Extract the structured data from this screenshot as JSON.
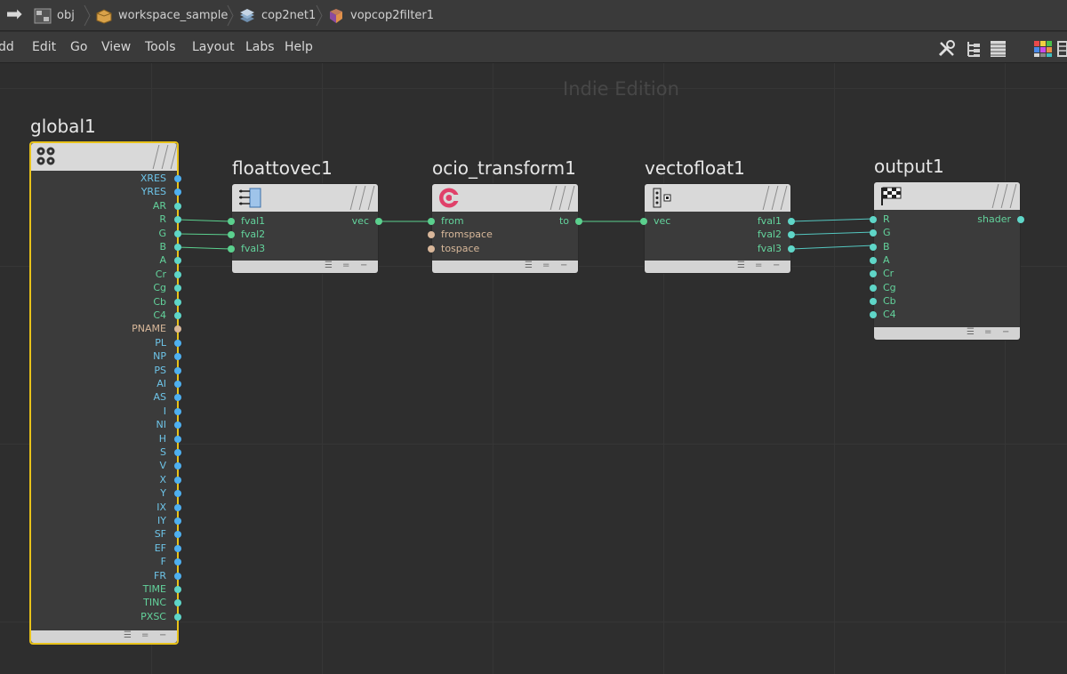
{
  "breadcrumb": {
    "items": [
      {
        "label": "obj",
        "icon": "obj-network-icon"
      },
      {
        "label": "workspace_sample",
        "icon": "subnet-box-icon"
      },
      {
        "label": "cop2net1",
        "icon": "cop2net-layers-icon"
      },
      {
        "label": "vopcop2filter1",
        "icon": "vopcop2filter-icon"
      }
    ]
  },
  "menu": {
    "items": [
      "dd",
      "Edit",
      "Go",
      "View",
      "Tools",
      "Layout",
      "Labs",
      "Help"
    ]
  },
  "canvas": {
    "watermark": "Indie Edition"
  },
  "nodes": {
    "global1": {
      "title": "global1",
      "outputs": [
        "XRES",
        "YRES",
        "AR",
        "R",
        "G",
        "B",
        "A",
        "Cr",
        "Cg",
        "Cb",
        "C4",
        "PNAME",
        "PL",
        "NP",
        "PS",
        "AI",
        "AS",
        "I",
        "NI",
        "H",
        "S",
        "V",
        "X",
        "Y",
        "IX",
        "IY",
        "SF",
        "EF",
        "F",
        "FR",
        "TIME",
        "TINC",
        "PXSC"
      ]
    },
    "floattovec1": {
      "title": "floattovec1",
      "inputs": [
        "fval1",
        "fval2",
        "fval3"
      ],
      "outputs": [
        "vec"
      ]
    },
    "ocio_transform1": {
      "title": "ocio_transform1",
      "inputs": [
        "from",
        "fromspace",
        "tospace"
      ],
      "outputs": [
        "to"
      ]
    },
    "vectofloat1": {
      "title": "vectofloat1",
      "inputs": [
        "vec"
      ],
      "outputs": [
        "fval1",
        "fval2",
        "fval3"
      ]
    },
    "output1": {
      "title": "output1",
      "inputs": [
        "R",
        "G",
        "B",
        "A",
        "Cr",
        "Cg",
        "Cb",
        "C4"
      ],
      "outputs": [
        "shader"
      ]
    }
  },
  "footer_glyphs": [
    "☰",
    "=",
    "−"
  ],
  "colors": {
    "selected_border": "#e8c21a",
    "wire": "#5bd08e",
    "wire_teal": "#54c7c0",
    "port_blue": "#4fb0f0",
    "port_green": "#5bd08e",
    "port_tan": "#d9b79a"
  }
}
